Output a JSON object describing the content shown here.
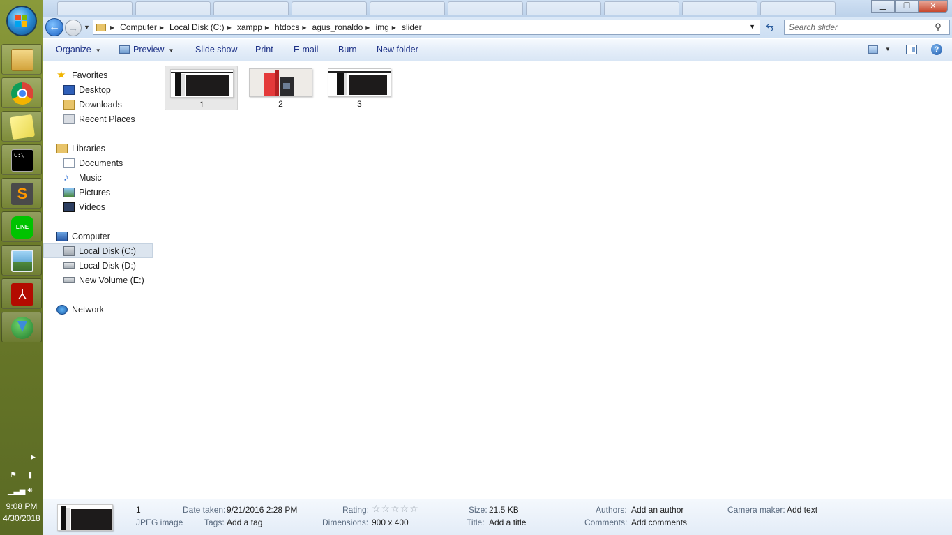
{
  "clock": {
    "time": "9:08 PM",
    "date": "4/30/2018"
  },
  "address": {
    "crumbs": [
      "Computer",
      "Local Disk (C:)",
      "xampp",
      "htdocs",
      "agus_ronaldo",
      "img",
      "slider"
    ]
  },
  "search": {
    "placeholder": "Search slider"
  },
  "toolbar": {
    "organize": "Organize",
    "preview": "Preview",
    "slideshow": "Slide show",
    "print": "Print",
    "email": "E-mail",
    "burn": "Burn",
    "new_folder": "New folder"
  },
  "nav": {
    "favorites": "Favorites",
    "desktop": "Desktop",
    "downloads": "Downloads",
    "recent_places": "Recent Places",
    "libraries": "Libraries",
    "documents": "Documents",
    "music": "Music",
    "pictures": "Pictures",
    "videos": "Videos",
    "computer": "Computer",
    "local_disk_c": "Local Disk (C:)",
    "local_disk_d": "Local Disk (D:)",
    "new_volume_e": "New Volume (E:)",
    "network": "Network"
  },
  "files": [
    {
      "name": "1",
      "selected": true
    },
    {
      "name": "2",
      "selected": false
    },
    {
      "name": "3",
      "selected": false
    }
  ],
  "details": {
    "filename": "1",
    "filetype": "JPEG image",
    "date_taken_label": "Date taken:",
    "date_taken": "9/21/2016 2:28 PM",
    "tags_label": "Tags:",
    "tags": "Add a tag",
    "rating_label": "Rating:",
    "rating": 0,
    "dimensions_label": "Dimensions:",
    "dimensions": "900 x 400",
    "size_label": "Size:",
    "size": "21.5 KB",
    "title_label": "Title:",
    "title": "Add a title",
    "authors_label": "Authors:",
    "authors": "Add an author",
    "comments_label": "Comments:",
    "comments": "Add comments",
    "camera_label": "Camera maker:",
    "camera": "Add text"
  },
  "icons": {
    "start": "windows-start-orb",
    "taskbar": [
      "windows-explorer",
      "chrome",
      "sticky-notes",
      "command-prompt",
      "sublime-text",
      "line",
      "photo-viewer",
      "acrobat-reader",
      "internet-download-manager"
    ]
  }
}
